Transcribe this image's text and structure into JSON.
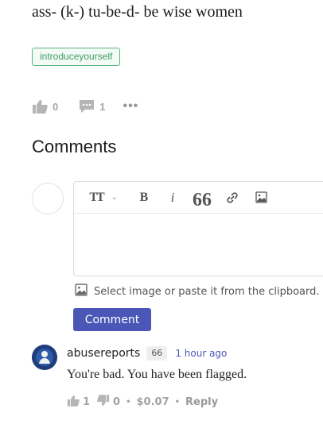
{
  "post": {
    "text": "ass- (k-) tu-be-d- be wise women",
    "tag": "introduceyourself",
    "likes": "0",
    "comments": "1",
    "more": "•••"
  },
  "comments_section": {
    "heading": "Comments",
    "editor": {
      "toolbar": {
        "text_size": "TT",
        "chevron": "⌄",
        "bold": "B",
        "italic": "i",
        "quote": "66"
      },
      "image_hint": "Select image or paste it from the clipboard.",
      "submit_label": "Comment"
    }
  },
  "comment": {
    "username": "abusereports",
    "reputation": "66",
    "time": "1 hour ago",
    "text": "You're bad. You have been flagged.",
    "upvotes": "1",
    "downvotes": "0",
    "payout": "$0.07",
    "separator": "•",
    "reply_label": "Reply"
  },
  "icons": {
    "like": "thumbs-up-icon",
    "comment": "speech-bubble-icon",
    "link": "link-icon",
    "image": "image-icon",
    "downvote": "thumbs-down-icon"
  },
  "colors": {
    "accent": "#4a57b6",
    "tag": "#3f9b66",
    "muted": "#a6a6a6"
  }
}
